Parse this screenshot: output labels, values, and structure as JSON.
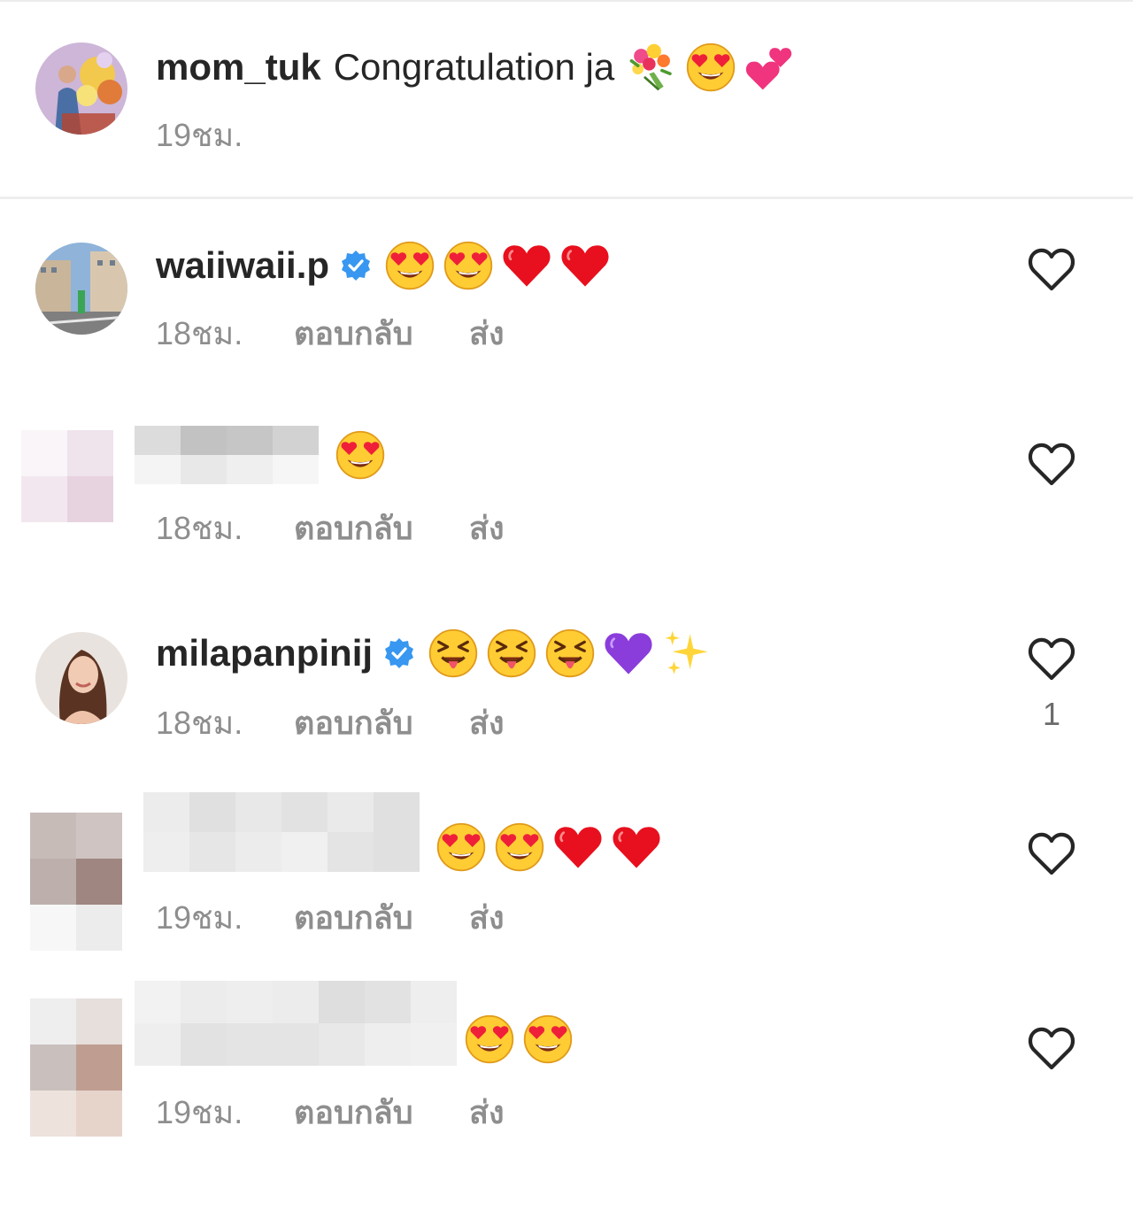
{
  "caption": {
    "username": "mom_tuk",
    "text": "Congratulation ja",
    "emojis": [
      "bouquet-emoji",
      "heart-eyes-emoji",
      "two-hearts-emoji"
    ],
    "time": "19ชม."
  },
  "comments": [
    {
      "username": "waiiwaii.p",
      "verified": true,
      "emojis": [
        "heart-eyes-emoji",
        "heart-eyes-emoji",
        "red-heart-emoji",
        "red-heart-emoji"
      ],
      "time": "18ชม.",
      "reply_label": "ตอบกลับ",
      "send_label": "ส่ง"
    },
    {
      "username": "",
      "blurred": true,
      "emojis": [
        "heart-eyes-emoji"
      ],
      "time": "18ชม.",
      "reply_label": "ตอบกลับ",
      "send_label": "ส่ง"
    },
    {
      "username": "milapanpinij",
      "verified": true,
      "emojis": [
        "squinting-tongue-emoji",
        "squinting-tongue-emoji",
        "squinting-tongue-emoji",
        "purple-heart-emoji",
        "sparkles-emoji"
      ],
      "time": "18ชม.",
      "reply_label": "ตอบกลับ",
      "send_label": "ส่ง",
      "like_count": "1"
    },
    {
      "username": "",
      "blurred": true,
      "emojis": [
        "heart-eyes-emoji",
        "heart-eyes-emoji",
        "red-heart-emoji",
        "red-heart-emoji"
      ],
      "time": "19ชม.",
      "reply_label": "ตอบกลับ",
      "send_label": "ส่ง"
    },
    {
      "username": "",
      "blurred": true,
      "emojis": [
        "heart-eyes-emoji",
        "heart-eyes-emoji"
      ],
      "time": "19ชม.",
      "reply_label": "ตอบกลับ",
      "send_label": "ส่ง"
    }
  ],
  "colors": {
    "text": "#262626",
    "muted": "#8e8e8e",
    "verified_blue": "#3897f0",
    "divider": "#eeeeee"
  }
}
